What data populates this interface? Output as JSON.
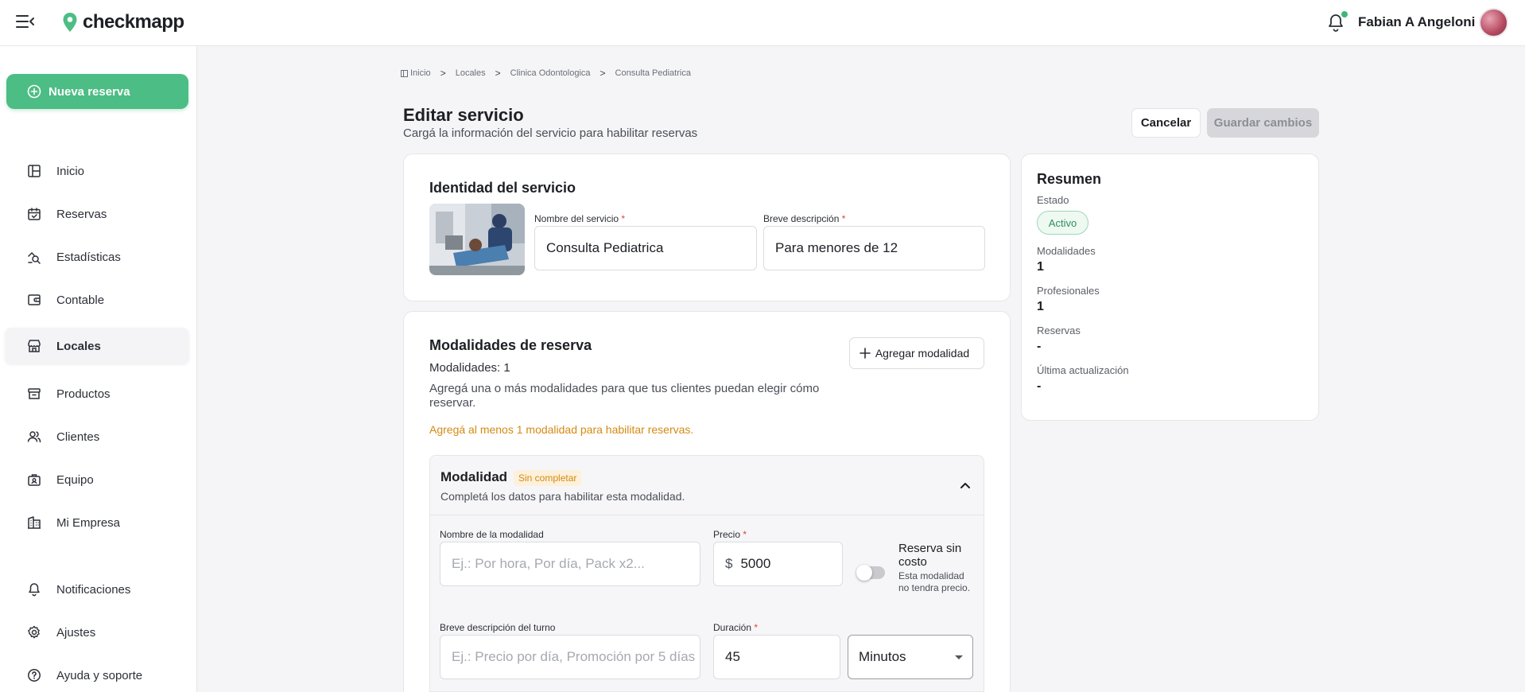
{
  "app": {
    "logo_text": "checkmapp",
    "brand_color": "#4cbd84"
  },
  "header": {
    "user_name": "Fabian A Angeloni"
  },
  "sidebar": {
    "new_booking_label": "Nueva reserva",
    "items": [
      {
        "label": "Inicio",
        "icon": "dashboard-icon"
      },
      {
        "label": "Reservas",
        "icon": "calendar-check-icon"
      },
      {
        "label": "Estadísticas",
        "icon": "stats-icon"
      },
      {
        "label": "Contable",
        "icon": "wallet-icon"
      },
      {
        "label": "Locales",
        "icon": "store-icon",
        "active": true
      },
      {
        "label": "Productos",
        "icon": "archive-icon"
      },
      {
        "label": "Clientes",
        "icon": "users-icon"
      },
      {
        "label": "Equipo",
        "icon": "team-icon"
      },
      {
        "label": "Mi Empresa",
        "icon": "building-icon"
      }
    ],
    "bottom_items": [
      {
        "label": "Notificaciones",
        "icon": "bell-icon"
      },
      {
        "label": "Ajustes",
        "icon": "gear-icon"
      },
      {
        "label": "Ayuda y soporte",
        "icon": "help-icon"
      }
    ]
  },
  "breadcrumb": [
    "Inicio",
    "Locales",
    "Clinica Odontologica",
    "Consulta Pediatrica"
  ],
  "breadcrumb_sep": ">",
  "page": {
    "title": "Editar servicio",
    "subtitle": "Cargá la información del servicio para habilitar reservas",
    "cancel_label": "Cancelar",
    "save_label": "Guardar cambios"
  },
  "identity": {
    "title": "Identidad del servicio",
    "name_label": "Nombre del servicio",
    "name_value": "Consulta Pediatrica",
    "desc_label": "Breve descripción",
    "desc_value": "Para menores de 12",
    "required_mark": "*"
  },
  "modalities": {
    "title": "Modalidades de reserva",
    "count_text": "Modalidades: 1",
    "help_text": "Agregá una o más modalidades para que tus clientes puedan elegir cómo reservar.",
    "warning_text": "Agregá al menos 1 modalidad para habilitar reservas.",
    "warning_color": "#d48a12",
    "add_label": "Agregar modalidad",
    "modality": {
      "title": "Modalidad",
      "status_badge": "Sin completar",
      "subtitle": "Completá los datos para habilitar esta modalidad.",
      "name_label": "Nombre de la modalidad",
      "name_placeholder": "Ej.: Por hora, Por día, Pack x2...",
      "price_label": "Precio",
      "currency": "$",
      "price_value": "5000",
      "free_title": "Reserva sin costo",
      "free_help": "Esta modalidad no tendra precio.",
      "free_enabled": false,
      "turn_desc_label": "Breve descripción del turno",
      "turn_desc_placeholder": "Ej.: Precio por día, Promoción por 5 días",
      "duration_label": "Duración",
      "duration_value": "45",
      "duration_unit": "Minutos"
    }
  },
  "summary": {
    "title": "Resumen",
    "status_label": "Estado",
    "status_value": "Activo",
    "modalities_label": "Modalidades",
    "modalities_value": "1",
    "professionals_label": "Profesionales",
    "professionals_value": "1",
    "bookings_label": "Reservas",
    "bookings_value": "-",
    "updated_label": "Última actualización",
    "updated_value": "-"
  }
}
